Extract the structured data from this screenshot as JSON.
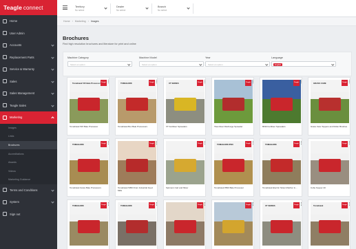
{
  "brand": {
    "name": "Teagle",
    "suffix": "connect"
  },
  "topbar": {
    "selects": [
      {
        "label": "Territory",
        "value": "No select"
      },
      {
        "label": "Dealer",
        "value": "No select"
      },
      {
        "label": "Branch",
        "value": "No select"
      }
    ]
  },
  "sidebar": {
    "items": [
      {
        "label": "Home",
        "icon": "home-icon"
      },
      {
        "label": "User Admin",
        "icon": "user-icon"
      },
      {
        "label": "Accounts",
        "icon": "accounts-icon",
        "expandable": true
      },
      {
        "label": "Replacement Parts",
        "icon": "parts-icon",
        "expandable": true
      },
      {
        "label": "Service & Warranty",
        "icon": "wrench-icon",
        "expandable": true
      },
      {
        "label": "Sales",
        "icon": "chart-icon",
        "expandable": true
      },
      {
        "label": "Sales Management",
        "icon": "star-icon",
        "expandable": true
      },
      {
        "label": "Teagle Sales",
        "icon": "tag-icon",
        "expandable": true
      },
      {
        "label": "Marketing",
        "icon": "megaphone-icon",
        "expandable": true,
        "active": true
      }
    ],
    "marketing_sub": [
      {
        "label": "Images"
      },
      {
        "label": "Links"
      },
      {
        "label": "Brochures",
        "active": true
      },
      {
        "label": "Accreditations"
      },
      {
        "label": "Awards"
      },
      {
        "label": "Videos"
      },
      {
        "label": "Marketing Guidance"
      }
    ],
    "bottom_items": [
      {
        "label": "Terms and Conditions",
        "icon": "document-icon",
        "expandable": true
      },
      {
        "label": "System",
        "icon": "cog-icon",
        "expandable": true
      },
      {
        "label": "Sign out",
        "icon": "signout-icon"
      }
    ]
  },
  "breadcrumb": [
    "Home",
    "Marketing",
    "Images"
  ],
  "page": {
    "title": "Brochures",
    "subtitle": "Find high resolution brochures and literature for print and online"
  },
  "filters": [
    {
      "label": "Machine Category",
      "placeholder": "Select an option"
    },
    {
      "label": "Machine Model",
      "placeholder": "Select an option"
    },
    {
      "label": "Year",
      "placeholder": "Select an option"
    },
    {
      "label": "Language",
      "chip": "English"
    }
  ],
  "brochures": [
    {
      "header": "Tomahawk 515 Bale Processor",
      "caption": "Tomahawk 515 Bale Processor",
      "sky": "#f1f1f1",
      "ground": "#8a9a5b",
      "machine": "#c9262c",
      "white": true
    },
    {
      "header": "TOMAHAWK",
      "caption": "Tomahawk Box Bale Processors",
      "sky": "#f1f1f1",
      "ground": "#b89a6b",
      "machine": "#c32a2a",
      "white": true
    },
    {
      "header": "XT SERIES",
      "caption": "XT Fertiliser Spreaders",
      "sky": "#f1f1f1",
      "ground": "#8d8e80",
      "machine": "#d9b624",
      "white": true
    },
    {
      "header": "",
      "caption": "Titan Rear Discharge Spreader",
      "sky": "#a8c1d6",
      "ground": "#6d9a3c",
      "machine": "#b22d2d",
      "white": false
    },
    {
      "header": "",
      "caption": "8030 Fertiliser Spreaders",
      "sky": "#3a5fa0",
      "ground": "#4d7a2f",
      "machine": "#c9262c",
      "white": false
    },
    {
      "header": "GRASS CARE",
      "caption": "Grass Care Toppers and Roller Brushes",
      "sky": "#f1f1f1",
      "ground": "#6a8f3e",
      "machine": "#b8302e",
      "white": true
    },
    {
      "header": "TOMAHAWK",
      "caption": "Tomahawk Grass Bale Processors",
      "sky": "#f1f1f1",
      "ground": "#a88c52",
      "machine": "#c9262c",
      "white": true
    },
    {
      "header": "",
      "caption": "Tomahawk 5050 Drum Industrial Feed Mills",
      "sky": "#e8d6c4",
      "ground": "#9e7c5a",
      "machine": "#b72a2a",
      "white": false
    },
    {
      "header": "",
      "caption": "Spinners Cart and Mixer",
      "sky": "#f1f1f1",
      "ground": "#9ba38d",
      "machine": "#d6a930",
      "white": true
    },
    {
      "header": "TOMAHAWK 8500",
      "caption": "Tomahawk 8500 Bale Processor",
      "sky": "#f1f1f1",
      "ground": "#b0904f",
      "machine": "#c9262c",
      "white": true
    },
    {
      "header": "TOMAHAWK",
      "caption": "Tomahawk Electric Straw Mulcher & ...",
      "sky": "#f1f1f1",
      "ground": "#8f7d5c",
      "machine": "#c32a2a",
      "white": true
    },
    {
      "header": "",
      "caption": "Cube Keeper 20",
      "sky": "#f1f1f1",
      "ground": "#998e80",
      "machine": "#c9262c",
      "white": true
    },
    {
      "header": "TOMAHAWK",
      "caption": "",
      "sky": "#f1f1f1",
      "ground": "#9a8a62",
      "machine": "#c9262c",
      "white": true
    },
    {
      "header": "TOMAHAWK",
      "caption": "",
      "sky": "#f1f1f1",
      "ground": "#7a7066",
      "machine": "#b22d2d",
      "white": true
    },
    {
      "header": "",
      "caption": "",
      "sky": "#e3d7c9",
      "ground": "#8e7a66",
      "machine": "#c9262c",
      "white": false
    },
    {
      "header": "",
      "caption": "",
      "sky": "#b8c9d8",
      "ground": "#a38a5a",
      "machine": "#d3a52e",
      "white": false
    },
    {
      "header": "XT SERIES",
      "caption": "",
      "sky": "#f1f1f1",
      "ground": "#8e8d80",
      "machine": "#c9262c",
      "white": true
    },
    {
      "header": "Tomahawk",
      "caption": "",
      "sky": "#f1f1f1",
      "ground": "#8f7e64",
      "machine": "#c9262c",
      "white": true
    }
  ],
  "colors": {
    "accent": "#d92333",
    "sidebar": "#2e3138"
  }
}
